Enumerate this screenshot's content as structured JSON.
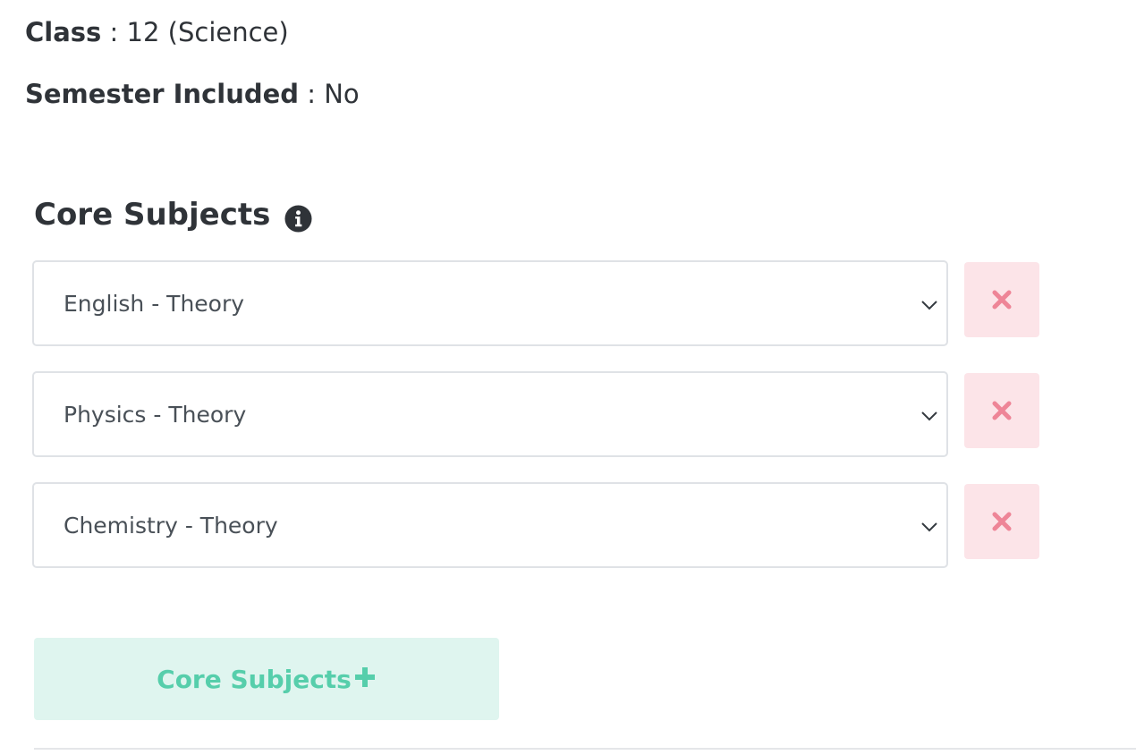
{
  "info": {
    "class_label": "Class",
    "class_value": ": 12 (Science)",
    "semester_label": "Semester Included",
    "semester_value": ": No"
  },
  "core_subjects": {
    "title": "Core Subjects",
    "info_icon": "info-circle-icon",
    "rows": [
      {
        "selected": "English - Theory"
      },
      {
        "selected": "Physics - Theory"
      },
      {
        "selected": "Chemistry - Theory"
      }
    ],
    "remove_icon": "close-icon",
    "add_button_label": "Core Subjects",
    "add_icon": "plus-icon"
  },
  "colors": {
    "remove_bg": "#fce4e8",
    "remove_icon": "#ee8597",
    "add_bg": "#dff5ef",
    "add_text": "#56ceab",
    "text": "#2f3338"
  }
}
